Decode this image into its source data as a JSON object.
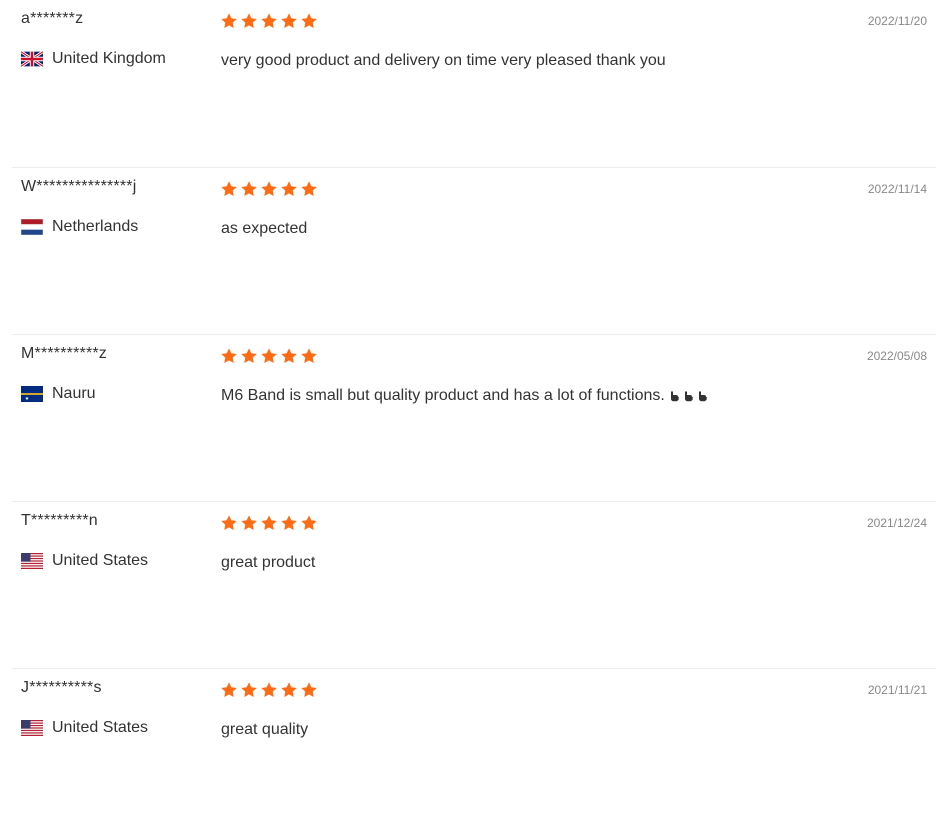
{
  "accent_color": "#ff6a14",
  "reviews": [
    {
      "username": "a*******z",
      "country": "United Kingdom",
      "flag": "uk-flag-icon",
      "rating": 5,
      "date": "2022/11/20",
      "text": "very good product and delivery on time very pleased thank you"
    },
    {
      "username": "W***************j",
      "country": "Netherlands",
      "flag": "netherlands-flag-icon",
      "rating": 5,
      "date": "2022/11/14",
      "text": "as expected"
    },
    {
      "username": "M**********z",
      "country": "Nauru",
      "flag": "nauru-flag-icon",
      "rating": 5,
      "date": "2022/05/08",
      "text": "M6 Band is small but quality product and has a lot of functions.",
      "emoji": "pointing-hand-icon x3"
    },
    {
      "username": "T*********n",
      "country": "United States",
      "flag": "us-flag-icon",
      "rating": 5,
      "date": "2021/12/24",
      "text": "great product"
    },
    {
      "username": "J**********s",
      "country": "United States",
      "flag": "us-flag-icon",
      "rating": 5,
      "date": "2021/11/21",
      "text": "great quality"
    }
  ]
}
